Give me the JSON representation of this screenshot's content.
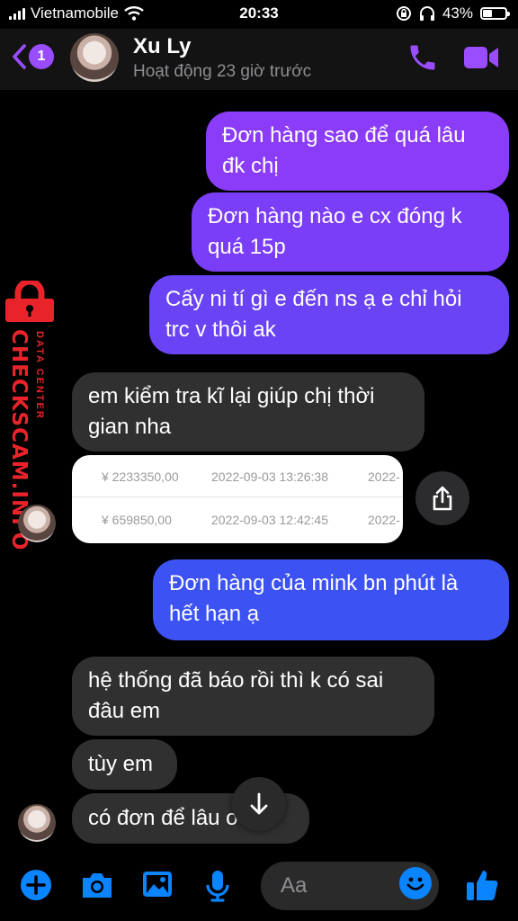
{
  "status_bar": {
    "carrier": "Vietnamobile",
    "time": "20:33",
    "battery": "43%",
    "battery_level": 0.43
  },
  "header": {
    "back_badge": "1",
    "contact_name": "Xu Ly",
    "activity_status": "Hoạt động 23 giờ trước",
    "accent_color": "#9a4dff"
  },
  "messages": [
    {
      "sender": "me",
      "lines": [
        "Đơn hàng sao để quá lâu",
        "đk chị"
      ]
    },
    {
      "sender": "me",
      "lines": [
        "Đơn hàng nào e cx đóng k",
        "quá 15p"
      ]
    },
    {
      "sender": "me",
      "lines": [
        "Cấy ni tí gì e đến ns ạ e chỉ hỏi",
        "trc v thôi ak"
      ]
    },
    {
      "sender": "them",
      "lines": [
        "em kiểm tra kĩ lại giúp chị thời",
        "gian nha"
      ]
    },
    {
      "sender": "them",
      "type": "image",
      "rows": [
        {
          "amount": "¥ 2233350,00",
          "datetime": "2022-09-03 13:26:38",
          "cut": "2022-"
        },
        {
          "amount": "¥ 659850,00",
          "datetime": "2022-09-03 12:42:45",
          "cut": "2022-"
        }
      ]
    },
    {
      "sender": "me",
      "lines": [
        "Đơn hàng của mink bn phút là",
        "hết hạn ạ"
      ]
    },
    {
      "sender": "them",
      "lines": [
        "hệ thống đã báo rồi thì k có sai",
        "đâu em"
      ]
    },
    {
      "sender": "them",
      "lines": [
        "tùy em"
      ]
    },
    {
      "sender": "them",
      "lines": [
        "có đơn để lâu      o"
      ]
    }
  ],
  "watermark": {
    "brand": "CHECKSCAM.INFO",
    "tagline": "DATA CENTER",
    "color": "#e8242a"
  },
  "composer": {
    "placeholder": "Aa",
    "icons": [
      "plus-icon",
      "camera-icon",
      "gallery-icon",
      "microphone-icon",
      "emoji-icon",
      "thumbs-up-icon"
    ],
    "icon_color": "#0a84ff"
  }
}
